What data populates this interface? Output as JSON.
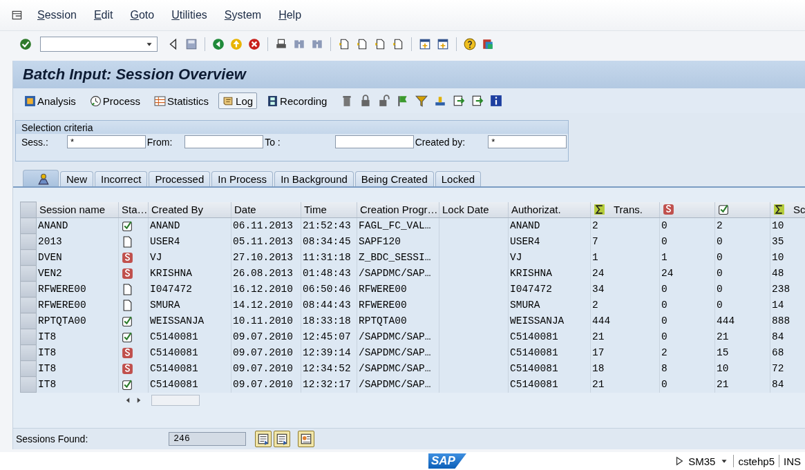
{
  "menu": [
    {
      "label": "Session"
    },
    {
      "label": "Edit"
    },
    {
      "label": "Goto"
    },
    {
      "label": "Utilities"
    },
    {
      "label": "System"
    },
    {
      "label": "Help"
    }
  ],
  "title": "Batch Input: Session Overview",
  "app_toolbar": [
    {
      "label": "Analysis",
      "pressed": false
    },
    {
      "label": "Process",
      "pressed": false
    },
    {
      "label": "Statistics",
      "pressed": false
    },
    {
      "label": "Log",
      "pressed": true
    },
    {
      "label": "Recording",
      "pressed": false
    }
  ],
  "selection_criteria": {
    "title": "Selection criteria",
    "fields": [
      {
        "label": "Sess.:",
        "value": "*"
      },
      {
        "label": "From:"
      },
      {
        "label": "To :"
      },
      {
        "label": "Created by:",
        "value": "*"
      }
    ]
  },
  "tabs": [
    {
      "kind": "icon",
      "selected": true
    },
    {
      "kind": "text",
      "label": "New",
      "selected": false
    },
    {
      "kind": "text",
      "label": "Incorrect",
      "selected": false
    },
    {
      "kind": "text",
      "label": "Processed",
      "selected": false
    },
    {
      "kind": "text",
      "label": "In Process",
      "selected": false
    },
    {
      "kind": "text",
      "label": "In Background",
      "selected": false
    },
    {
      "kind": "text",
      "label": "Being Created",
      "selected": false
    },
    {
      "kind": "text",
      "label": "Locked",
      "selected": false
    }
  ],
  "table": {
    "columns": [
      {
        "label": "Session name"
      },
      {
        "label": "Sta…"
      },
      {
        "label": "Created By"
      },
      {
        "label": "Date"
      },
      {
        "label": "Time"
      },
      {
        "label": "Creation Progr…"
      },
      {
        "label": "Lock Date"
      },
      {
        "label": "Authorizat."
      },
      {
        "label": "Trans.",
        "kind": "sum"
      },
      {
        "kind": "incorrect"
      },
      {
        "kind": "processed"
      },
      {
        "label": "Sc",
        "kind": "sum"
      }
    ],
    "rows": [
      {
        "session_name": "ANAND",
        "kind": "processed",
        "created_by": "ANAND",
        "date": "06.11.2013",
        "time": "21:52:43",
        "creation_program": "FAGL_FC_VAL…",
        "authorization": "ANAND",
        "transactions": "2",
        "incorrect": "0",
        "processed": "2",
        "column_12": "10"
      },
      {
        "session_name": "2013",
        "kind": "new",
        "created_by": "USER4",
        "date": "05.11.2013",
        "time": "08:34:45",
        "creation_program": "SAPF120",
        "authorization": "USER4",
        "transactions": "7",
        "incorrect": "0",
        "processed": "0",
        "column_12": "35"
      },
      {
        "session_name": "DVEN",
        "kind": "incorrect",
        "created_by": "VJ",
        "date": "27.10.2013",
        "time": "11:31:18",
        "creation_program": "Z_BDC_SESSI…",
        "authorization": "VJ",
        "transactions": "1",
        "incorrect": "1",
        "processed": "0",
        "column_12": "10"
      },
      {
        "session_name": "VEN2",
        "kind": "incorrect",
        "created_by": "KRISHNA",
        "date": "26.08.2013",
        "time": "01:48:43",
        "creation_program": "/SAPDMC/SAP…",
        "authorization": "KRISHNA",
        "transactions": "24",
        "incorrect": "24",
        "processed": "0",
        "column_12": "48"
      },
      {
        "session_name": "RFWERE00",
        "kind": "new",
        "created_by": "I047472",
        "date": "16.12.2010",
        "time": "06:50:46",
        "creation_program": "RFWERE00",
        "authorization": "I047472",
        "transactions": "34",
        "incorrect": "0",
        "processed": "0",
        "column_12": "238"
      },
      {
        "session_name": "RFWERE00",
        "kind": "new",
        "created_by": "SMURA",
        "date": "14.12.2010",
        "time": "08:44:43",
        "creation_program": "RFWERE00",
        "authorization": "SMURA",
        "transactions": "2",
        "incorrect": "0",
        "processed": "0",
        "column_12": "14"
      },
      {
        "session_name": "RPTQTA00",
        "kind": "processed",
        "created_by": "WEISSANJA",
        "date": "10.11.2010",
        "time": "18:33:18",
        "creation_program": "RPTQTA00",
        "authorization": "WEISSANJA",
        "transactions": "444",
        "incorrect": "0",
        "processed": "444",
        "column_12": "888"
      },
      {
        "session_name": "IT8",
        "kind": "processed",
        "created_by": "C5140081",
        "date": "09.07.2010",
        "time": "12:45:07",
        "creation_program": "/SAPDMC/SAP…",
        "authorization": "C5140081",
        "transactions": "21",
        "incorrect": "0",
        "processed": "21",
        "column_12": "84"
      },
      {
        "session_name": "IT8",
        "kind": "incorrect",
        "created_by": "C5140081",
        "date": "09.07.2010",
        "time": "12:39:14",
        "creation_program": "/SAPDMC/SAP…",
        "authorization": "C5140081",
        "transactions": "17",
        "incorrect": "2",
        "processed": "15",
        "column_12": "68"
      },
      {
        "session_name": "IT8",
        "kind": "incorrect",
        "created_by": "C5140081",
        "date": "09.07.2010",
        "time": "12:34:52",
        "creation_program": "/SAPDMC/SAP…",
        "authorization": "C5140081",
        "transactions": "18",
        "incorrect": "8",
        "processed": "10",
        "column_12": "72"
      },
      {
        "session_name": "IT8",
        "kind": "processed",
        "created_by": "C5140081",
        "date": "09.07.2010",
        "time": "12:32:17",
        "creation_program": "/SAPDMC/SAP…",
        "authorization": "C5140081",
        "transactions": "21",
        "incorrect": "0",
        "processed": "21",
        "column_12": "84"
      }
    ]
  },
  "footer": {
    "label": "Sessions Found:",
    "value": "246"
  },
  "status_bar": {
    "logo": "SAP",
    "transaction": "SM35",
    "server": "cstehp5",
    "mode": "INS"
  }
}
